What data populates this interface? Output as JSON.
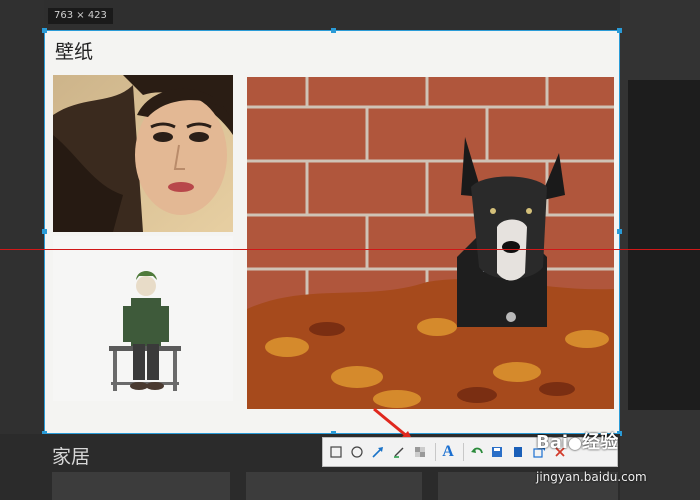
{
  "size_badge": "763 × 423",
  "wallpaper_section": {
    "title": "壁纸"
  },
  "home_section": {
    "title": "家居"
  },
  "toolbar": {
    "tools": [
      "rectangle-icon",
      "ellipse-icon",
      "arrow-icon",
      "pen-icon",
      "mosaic-icon",
      "text-icon",
      "undo-icon",
      "save-icon",
      "pin-icon",
      "share-icon",
      "close-icon",
      "confirm-icon"
    ],
    "text_tool_label": "A"
  },
  "watermark": {
    "brand": "Bai",
    "brand2": "经验",
    "url": "jingyan.baidu.com"
  },
  "colors": {
    "selection": "#2a9bd7",
    "guide_line": "#d01818",
    "arrow": "#e0281e"
  }
}
